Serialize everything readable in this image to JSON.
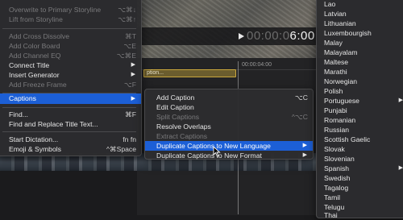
{
  "viewer": {
    "timecode_dim": "00:00:0",
    "timecode_bright": "6:00"
  },
  "timeline": {
    "ruler_label": "00:00:04:00",
    "caption_clip_label": "ption..."
  },
  "edit_menu": {
    "items": [
      {
        "label": "Overwrite to Primary Storyline",
        "shortcut": "⌥⌘↓",
        "disabled": true
      },
      {
        "label": "Lift from Storyline",
        "shortcut": "⌥⌘↑",
        "disabled": true
      },
      {
        "label": "Add Cross Dissolve",
        "shortcut": "⌘T",
        "disabled": true
      },
      {
        "label": "Add Color Board",
        "shortcut": "⌥E",
        "disabled": true
      },
      {
        "label": "Add Channel EQ",
        "shortcut": "⌥⌘E",
        "disabled": true
      },
      {
        "label": "Connect Title",
        "shortcut": "",
        "disabled": false
      },
      {
        "label": "Insert Generator",
        "shortcut": "",
        "disabled": false
      },
      {
        "label": "Add Freeze Frame",
        "shortcut": "⌥F",
        "disabled": true
      },
      {
        "label": "Captions",
        "shortcut": "",
        "disabled": false
      },
      {
        "label": "Find...",
        "shortcut": "⌘F",
        "disabled": false
      },
      {
        "label": "Find and Replace Title Text...",
        "shortcut": "",
        "disabled": false
      },
      {
        "label": "Start Dictation...",
        "shortcut": "fn fn",
        "disabled": false
      },
      {
        "label": "Emoji & Symbols",
        "shortcut": "^⌘Space",
        "disabled": false
      }
    ]
  },
  "captions_menu": {
    "items": [
      {
        "label": "Add Caption",
        "shortcut": "⌥C",
        "disabled": false
      },
      {
        "label": "Edit Caption",
        "shortcut": "",
        "disabled": false
      },
      {
        "label": "Split Captions",
        "shortcut": "^⌥C",
        "disabled": true
      },
      {
        "label": "Resolve Overlaps",
        "shortcut": "",
        "disabled": false
      },
      {
        "label": "Extract Captions",
        "shortcut": "",
        "disabled": true
      },
      {
        "label": "Duplicate Captions to New Language",
        "shortcut": "",
        "disabled": false
      },
      {
        "label": "Duplicate Captions to New Format",
        "shortcut": "",
        "disabled": false
      }
    ]
  },
  "language_menu": {
    "items": [
      "Lao",
      "Latvian",
      "Lithuanian",
      "Luxembourgish",
      "Malay",
      "Malayalam",
      "Maltese",
      "Marathi",
      "Norwegian",
      "Polish",
      "Portuguese",
      "Punjabi",
      "Romanian",
      "Russian",
      "Scottish Gaelic",
      "Slovak",
      "Slovenian",
      "Spanish",
      "Swedish",
      "Tagalog",
      "Tamil",
      "Telugu",
      "Thai"
    ]
  },
  "colors": {
    "highlight": "#1c5fd6",
    "menu_bg": "#2c2c2e",
    "disabled_text": "#7a7a7c"
  }
}
